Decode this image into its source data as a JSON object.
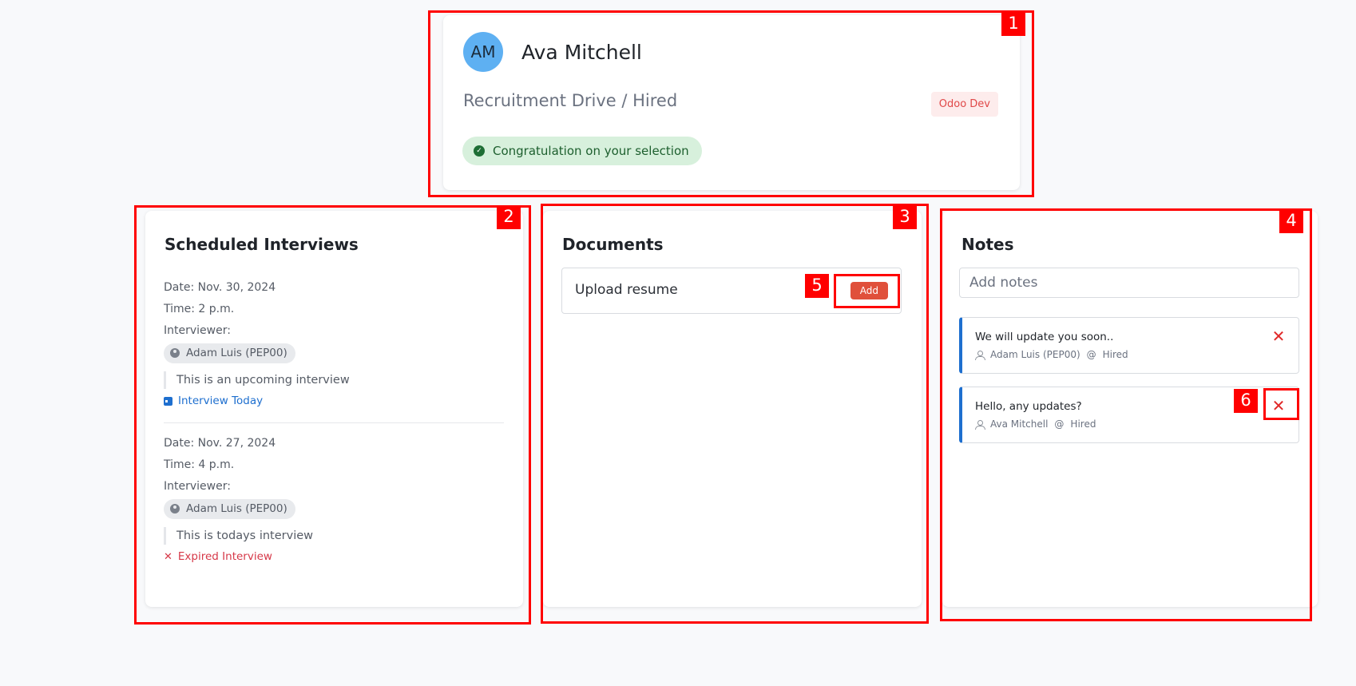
{
  "header": {
    "initials": "AM",
    "name": "Ava Mitchell",
    "stage": "Recruitment Drive / Hired",
    "company": "Odoo Dev",
    "alert": "Congratulation on your selection"
  },
  "interviews": {
    "title": "Scheduled Interviews",
    "items": [
      {
        "date": "Date: Nov. 30, 2024",
        "time": "Time: 2 p.m.",
        "interviewer_label": "Interviewer:",
        "interviewer": "Adam Luis (PEP00)",
        "note": "This is an upcoming interview",
        "status": "Interview Today"
      },
      {
        "date": "Date: Nov. 27, 2024",
        "time": "Time: 4 p.m.",
        "interviewer_label": "Interviewer:",
        "interviewer": "Adam Luis (PEP00)",
        "note": "This is todays interview",
        "status": "Expired Interview"
      }
    ]
  },
  "documents": {
    "title": "Documents",
    "rows": [
      {
        "label": "Upload resume",
        "action": "Add"
      }
    ]
  },
  "notes": {
    "title": "Notes",
    "placeholder": "Add notes",
    "items": [
      {
        "text": "We will update you soon..",
        "author": "Adam Luis (PEP00)",
        "at": "@",
        "stage": "Hired"
      },
      {
        "text": "Hello, any updates?",
        "author": "Ava Mitchell",
        "at": "@",
        "stage": "Hired"
      }
    ]
  },
  "annotations": [
    "1",
    "2",
    "3",
    "4",
    "5",
    "6"
  ],
  "colors": {
    "annotation": "#ff0000",
    "avatar": "#5eb0f2",
    "add_button": "#e0503b",
    "note_accent": "#1e6fcf",
    "success_bg": "#d7f0dc"
  }
}
